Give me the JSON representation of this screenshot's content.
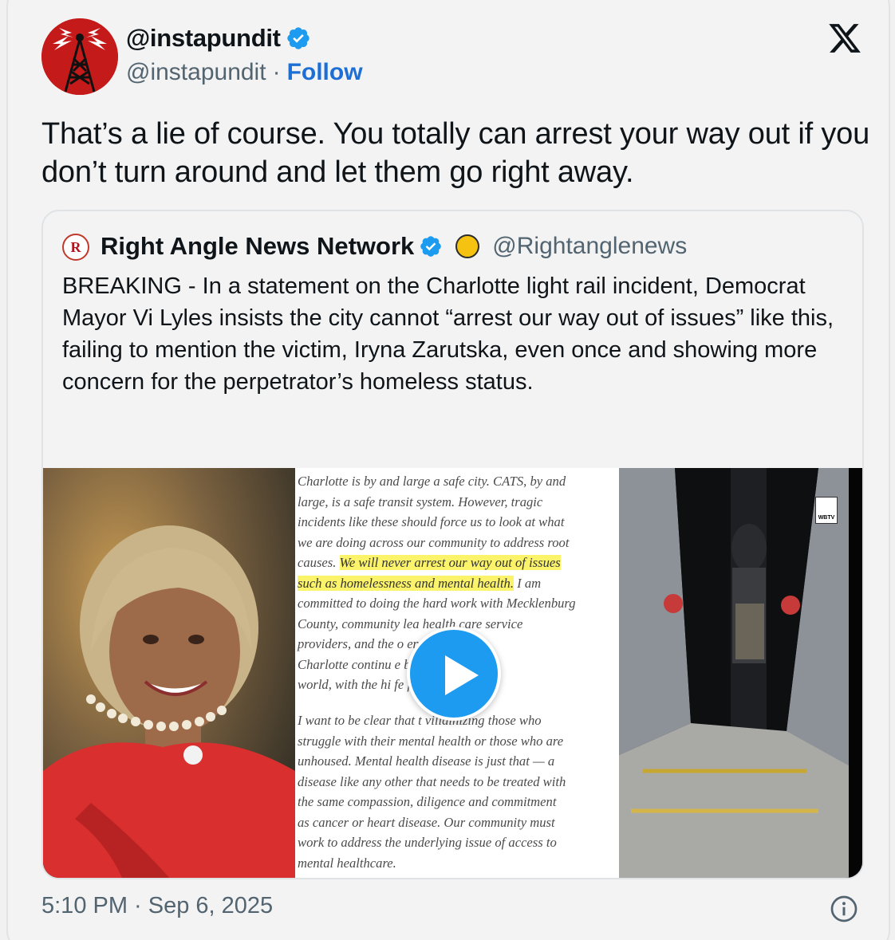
{
  "author": {
    "display_name": "@instapundit",
    "handle": "@instapundit",
    "separator": "·",
    "follow_label": "Follow",
    "verified": true
  },
  "tweet": {
    "text": "That’s a lie of course. You totally can arrest your way out if you don’t turn around and let them go right away."
  },
  "quoted": {
    "display_name": "Right Angle News Network",
    "handle": "@Rightanglenews",
    "avatar_letter": "R",
    "text": "BREAKING - In a statement on the Charlotte light rail incident, Democrat Mayor Vi Lyles insists the city cannot “arrest our way out of issues” like this, failing to mention the victim, Iryna Zarutska, even once and showing more concern for the perpetrator’s homeless status.",
    "media": {
      "doc_lines": [
        "Charlotte is by and large a safe city. CATS, by and",
        "large, is a safe transit system. However, tragic",
        "incidents like these should force us to look at what",
        "we are doing across our community to address root"
      ],
      "doc_line5_pre": "causes. ",
      "doc_line5_hl": "We will never arrest our way out of issues",
      "doc_line6_hl": "such as homelessness and mental health.",
      "doc_line6_post": " I am",
      "doc_lines_b": [
        "committed to doing the hard work with Mecklenburg",
        "County, community lea      health care service",
        "providers, and the                    o ensure that",
        "Charlotte continu                   e best cities in the",
        "world, with the hi                   fe for everyone."
      ],
      "doc_lines_c": [
        "I want to be clear that              t villainizing those who",
        "struggle with their mental health or those who are",
        "unhoused. Mental health disease is just that — a",
        "disease like any other that needs to be treated with",
        "the same compassion, diligence and commitment",
        "as cancer or heart disease. Our community must",
        "work to address the underlying issue of access to",
        "mental healthcare."
      ],
      "watermark": "WBTV"
    }
  },
  "timestamp": "5:10 PM · Sep 6, 2025",
  "colors": {
    "accent": "#1d9bf0",
    "follow": "#1d6fd6",
    "muted": "#536471",
    "highlight": "#fbf36a"
  },
  "icons": [
    "radio-tower-avatar-icon",
    "verified-badge-icon",
    "x-logo-icon",
    "play-icon",
    "info-icon",
    "yellow-circle-emoji-icon"
  ]
}
